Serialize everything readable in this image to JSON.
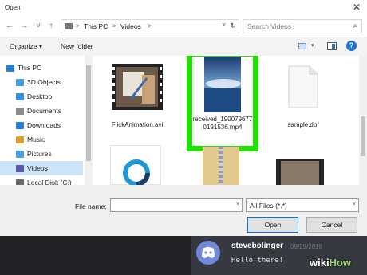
{
  "window": {
    "title": "Open",
    "close_glyph": "✕"
  },
  "nav": {
    "back_glyph": "←",
    "forward_glyph": "→",
    "recent_glyph": "˅",
    "up_glyph": "↑",
    "breadcrumb": [
      "This PC",
      "Videos"
    ],
    "separator": ">",
    "dropdown_glyph": "˅",
    "refresh_glyph": "↻",
    "search_placeholder": "Search Videos",
    "search_glyph": "⌕"
  },
  "toolbar": {
    "organize_label": "Organize ▾",
    "new_folder_label": "New folder",
    "view_drop_glyph": "▾",
    "help_glyph": "?"
  },
  "sidebar": {
    "items": [
      {
        "label": "This PC",
        "icon": "computer-icon",
        "color": "#2a7fd4"
      },
      {
        "label": "3D Objects",
        "icon": "folder-icon",
        "color": "#4a9fe0"
      },
      {
        "label": "Desktop",
        "icon": "folder-icon",
        "color": "#3a8ee0"
      },
      {
        "label": "Documents",
        "icon": "folder-icon",
        "color": "#8a8a8a"
      },
      {
        "label": "Downloads",
        "icon": "download-icon",
        "color": "#2a7fd4"
      },
      {
        "label": "Music",
        "icon": "music-icon",
        "color": "#e0a030"
      },
      {
        "label": "Pictures",
        "icon": "folder-icon",
        "color": "#4aa0d8"
      },
      {
        "label": "Videos",
        "icon": "video-icon",
        "color": "#5a5aa8"
      },
      {
        "label": "Local Disk (C:)",
        "icon": "drive-icon",
        "color": "#6a6a6a"
      }
    ]
  },
  "files": [
    {
      "name": "FlickAnimation.avi",
      "type": "video"
    },
    {
      "name": "received_1900796770191536.mp4",
      "type": "video",
      "highlighted": true
    },
    {
      "name": "sample.dbf",
      "type": "document"
    }
  ],
  "footer": {
    "file_name_label": "File name:",
    "file_name_value": "",
    "file_type_value": "All Files (*.*)",
    "dropdown_glyph": "˅",
    "open_label": "Open",
    "cancel_label": "Cancel"
  },
  "chat": {
    "username": "stevebolinger",
    "date": "09/29/2018",
    "message": "Hello there!"
  },
  "watermark": {
    "wiki": "wiki",
    "how": "How"
  },
  "colors": {
    "highlight": "#22e000",
    "discord_bg": "#36393f",
    "accent": "#0078d7"
  }
}
